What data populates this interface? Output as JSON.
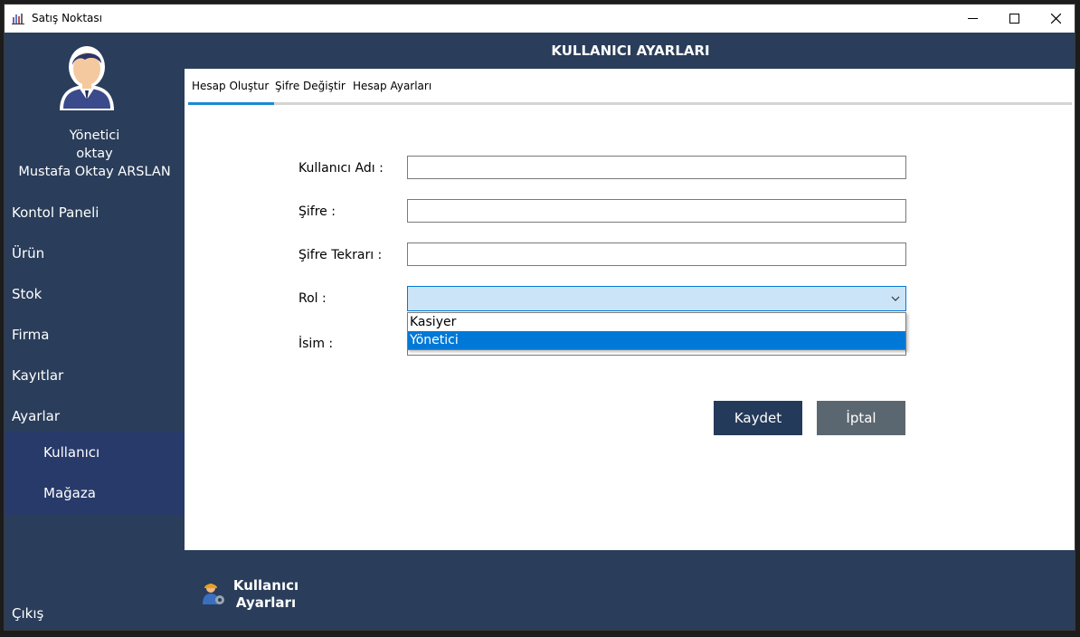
{
  "window": {
    "title": "Satış Noktası",
    "controls": {
      "minimize": "minimize-icon",
      "maximize": "maximize-icon",
      "close": "close-icon"
    }
  },
  "sidebar": {
    "user": {
      "role": "Yönetici",
      "username": "oktay",
      "full_name": "Mustafa Oktay ARSLAN"
    },
    "items": [
      {
        "label": "Kontol Paneli"
      },
      {
        "label": "Ürün"
      },
      {
        "label": "Stok"
      },
      {
        "label": "Firma"
      },
      {
        "label": "Kayıtlar"
      },
      {
        "label": "Ayarlar"
      }
    ],
    "subitems": [
      {
        "label": "Kullanıcı"
      },
      {
        "label": "Mağaza"
      }
    ],
    "exit_label": "Çıkış"
  },
  "header": {
    "title": "KULLANICI AYARLARI"
  },
  "tabs": [
    {
      "label": "Hesap Oluştur",
      "active": true
    },
    {
      "label": "Şifre Değiştir",
      "active": false
    },
    {
      "label": "Hesap Ayarları",
      "active": false
    }
  ],
  "form": {
    "username_label": "Kullanıcı Adı :",
    "username_value": "",
    "password_label": "Şifre :",
    "password_value": "",
    "password_repeat_label": "Şifre Tekrarı :",
    "password_repeat_value": "",
    "role_label": "Rol :",
    "role_value": "",
    "role_options": [
      "Kasiyer",
      "Yönetici"
    ],
    "role_highlighted": "Yönetici",
    "name_label": "İsim :",
    "name_value": ""
  },
  "buttons": {
    "save": "Kaydet",
    "cancel": "İptal"
  },
  "footer": {
    "line1": "Kullanıcı",
    "line2": "Ayarları"
  },
  "colors": {
    "sidebar_bg": "#2a3d5a",
    "subnav_bg": "#283a6a",
    "accent": "#1a8ad4",
    "selection": "#0078d7",
    "save_button": "#243a5a",
    "cancel_button": "#5b6770"
  }
}
